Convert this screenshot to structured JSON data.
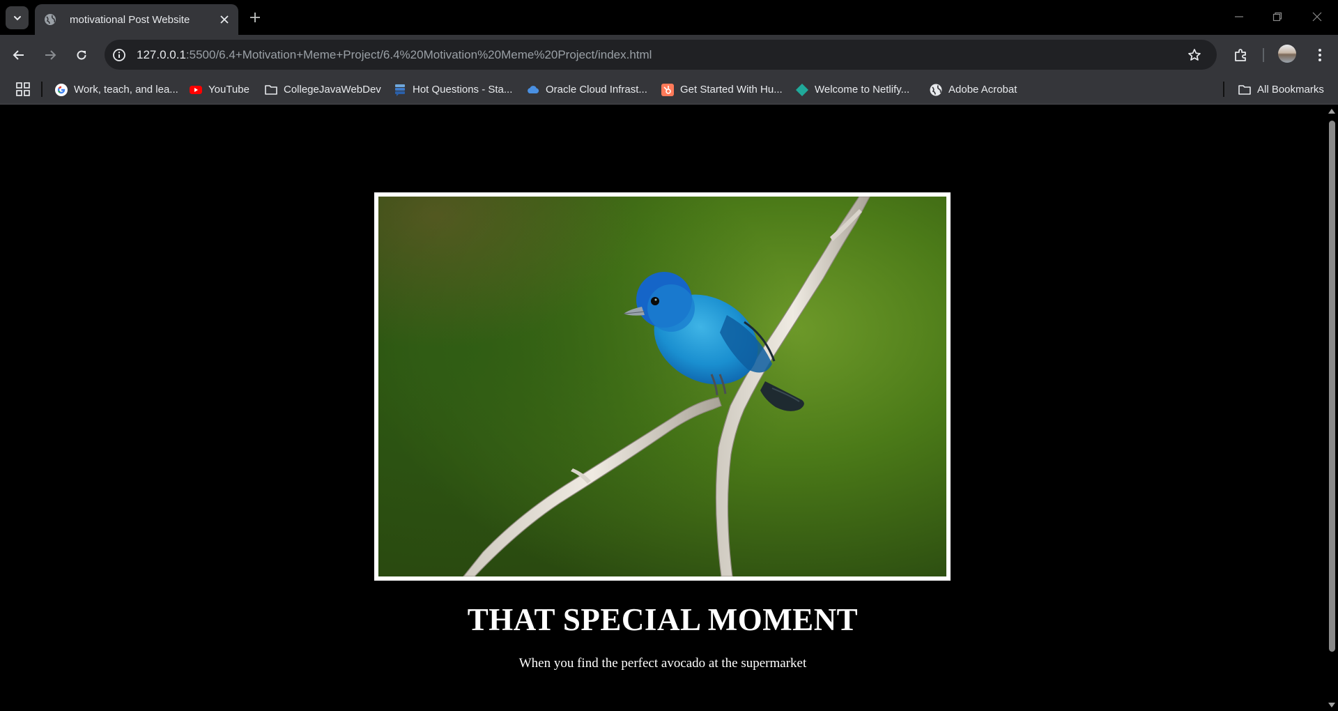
{
  "browser": {
    "tab": {
      "title": "motivational Post Website"
    },
    "address": {
      "host": "127.0.0.1",
      "path": ":5500/6.4+Motivation+Meme+Project/6.4%20Motivation%20Meme%20Project/index.html"
    },
    "bookmarks": [
      {
        "label": "Work, teach, and lea...",
        "icon": "google-icon"
      },
      {
        "label": "YouTube",
        "icon": "youtube-icon"
      },
      {
        "label": "CollegeJavaWebDev",
        "icon": "folder-icon"
      },
      {
        "label": "Hot Questions - Sta...",
        "icon": "stack-exchange-icon"
      },
      {
        "label": "Oracle Cloud Infrast...",
        "icon": "cloud-icon"
      },
      {
        "label": "Get Started With Hu...",
        "icon": "hubspot-icon"
      },
      {
        "label": "Welcome to Netlify...",
        "icon": "netlify-icon"
      },
      {
        "label": "Adobe Acrobat",
        "icon": "globe-icon"
      }
    ],
    "all_bookmarks": {
      "label": "All Bookmarks",
      "icon": "folder-icon"
    },
    "colors": {
      "frame": "#000000",
      "toolbar": "#35363a",
      "omnibox": "#202124"
    }
  },
  "poster": {
    "image": {
      "description_icon": "blue-bird-on-branch-photo"
    },
    "title": "THAT SPECIAL MOMENT",
    "caption": "When you find the perfect avocado at the supermarket"
  }
}
